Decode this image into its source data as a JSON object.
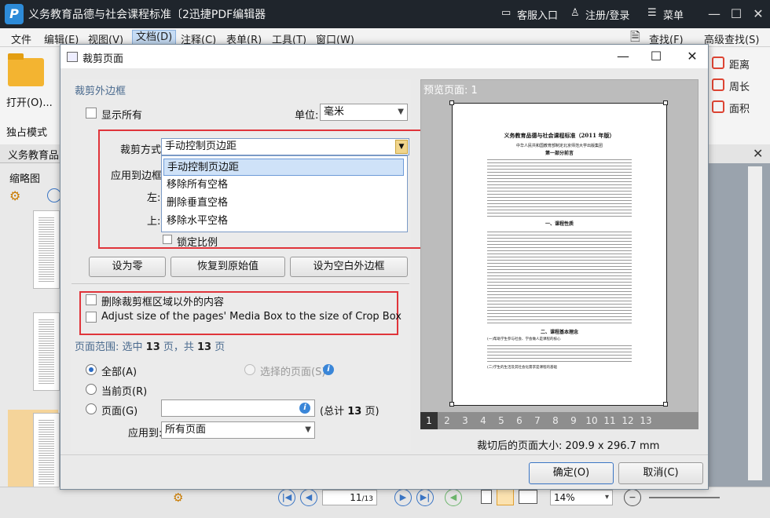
{
  "app": {
    "title": "义务教育品德与社会课程标准〔2迅捷PDF编辑器",
    "logo_letter": "P",
    "actions": {
      "service": "客服入口",
      "login": "注册/登录",
      "menu": "菜单"
    }
  },
  "menubar": [
    "文件",
    "编辑(E)",
    "视图(V)",
    "文档(D)",
    "注释(C)",
    "表单(R)",
    "工具(T)",
    "窗口(W)"
  ],
  "toolbar": {
    "find": "查找(F)",
    "advanced_find": "高级查找(S)",
    "open": "打开(O)...",
    "exclusive": "独占模式"
  },
  "doc_tab": "义务教育品德",
  "left_panel": {
    "title": "缩略图",
    "current_page": "11"
  },
  "right_ribbon": {
    "distance": "距离",
    "perimeter": "周长",
    "area": "面积"
  },
  "statusbar": {
    "page_value": "11",
    "page_total": "/13",
    "zoom": "14%"
  },
  "dialog": {
    "title": "裁剪页面",
    "crop_margins_label": "裁剪外边框",
    "show_all": "显示所有",
    "unit_label": "单位:",
    "unit_value": "毫米",
    "crop_method_label": "裁剪方式",
    "crop_method_value": "手动控制页边距",
    "apply_to_border_label": "应用到边框",
    "left_label": "左:",
    "top_label": "上:",
    "lock_ratio": "锁定比例",
    "dropdown_options": [
      "手动控制页边距",
      "移除所有空格",
      "删除垂直空格",
      "移除水平空格"
    ],
    "btn_zero": "设为零",
    "btn_restore": "恢复到原始值",
    "btn_blank": "设为空白外边框",
    "delete_outside": "删除裁剪框区域以外的内容",
    "adjust_media_box": "Adjust size of the pages' Media Box to the size of Crop Box",
    "page_range": {
      "prefix": "页面范围: 选中 ",
      "selected": "13",
      "mid": " 页，共 ",
      "total": "13",
      "suffix": " 页"
    },
    "all_label": "全部(A)",
    "current_label": "当前页(R)",
    "pages_label": "页面(G)",
    "selected_pages_label": "选择的页面(S)",
    "total_pages_prefix": "(总计 ",
    "total_pages_count": "13",
    "total_pages_suffix": " 页)",
    "apply_to_label": "应用到:",
    "apply_to_value": "所有页面",
    "preview_label": "预览页面: 1",
    "page_numbers": [
      "1",
      "2",
      "3",
      "4",
      "5",
      "6",
      "7",
      "8",
      "9",
      "10",
      "11",
      "12",
      "13"
    ],
    "crop_size": "裁切后的页面大小: 209.9 x 296.7 mm",
    "ok": "确定(O)",
    "cancel": "取消(C)",
    "preview_doc": {
      "title": "义务教育品德与社会课程标准（2011 年版）",
      "subtitle": "中华人民共和国教育部制定北京师范大学出版集团",
      "part1": "第一部分前言",
      "nature": "一、课程性质",
      "idea": "二、课程基本理念",
      "idea_item1": "(一)帮助学生参与社会、学会做人是课程的核心",
      "idea_item2": "(二)学生的生活及其社会化需求是课程的基础"
    }
  }
}
